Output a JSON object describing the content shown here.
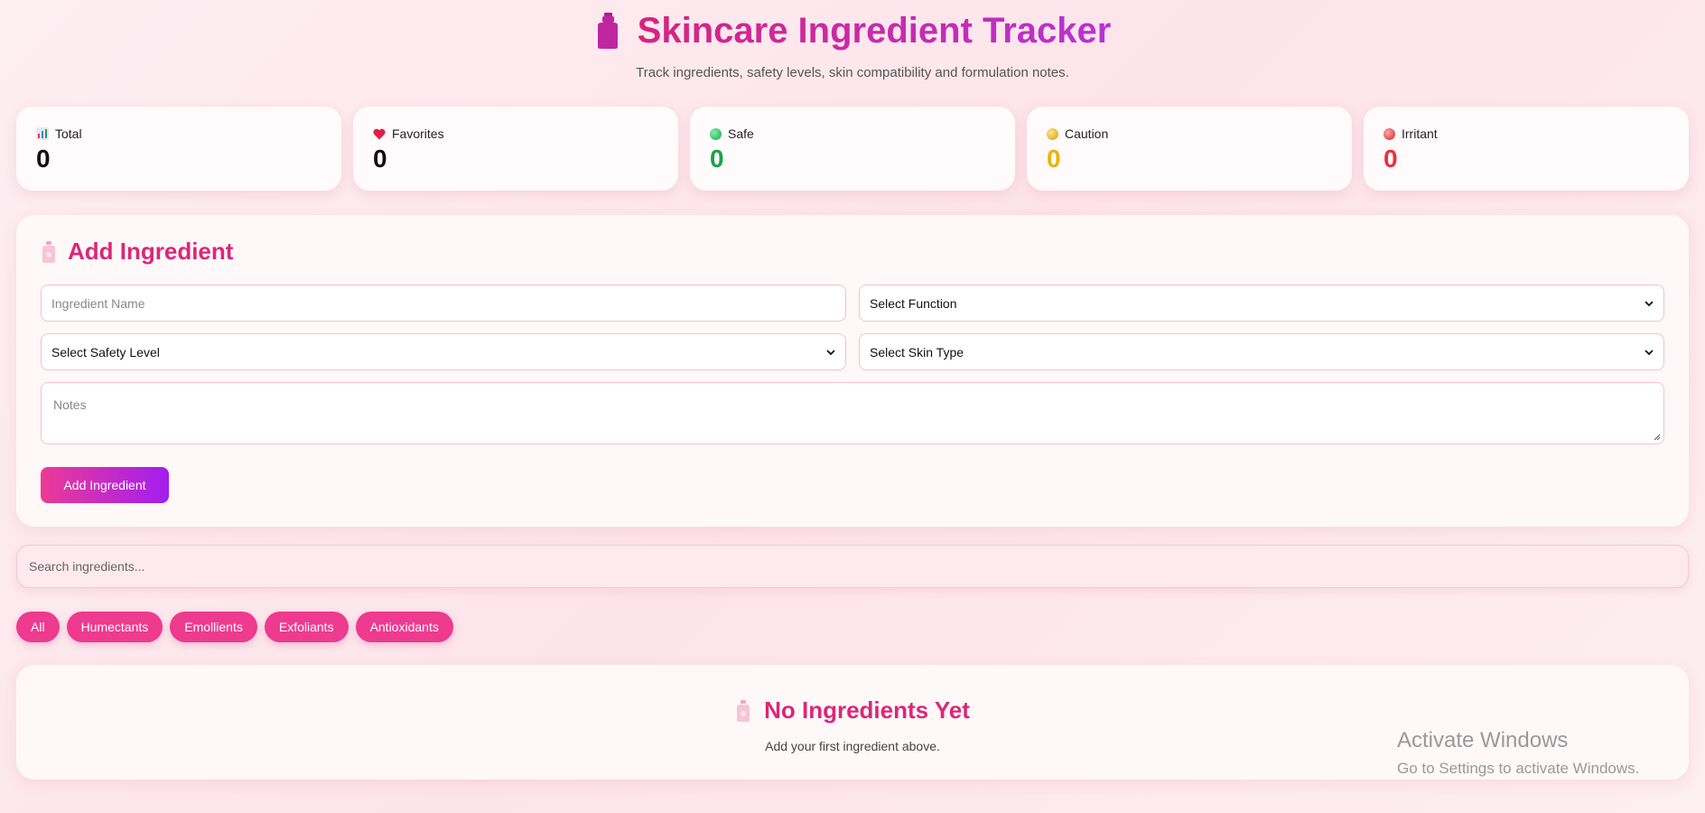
{
  "header": {
    "title": "Skincare Ingredient Tracker",
    "subtitle": "Track ingredients, safety levels, skin compatibility and formulation notes.",
    "icon": "lotion-bottle-icon"
  },
  "stats": [
    {
      "label": "Total",
      "value": "0",
      "icon": "bar-chart-icon",
      "color": "#111111"
    },
    {
      "label": "Favorites",
      "value": "0",
      "icon": "heart-icon",
      "color": "#111111"
    },
    {
      "label": "Safe",
      "value": "0",
      "icon": "green-circle-icon",
      "color": "#16a34a"
    },
    {
      "label": "Caution",
      "value": "0",
      "icon": "yellow-circle-icon",
      "color": "#eab308"
    },
    {
      "label": "Irritant",
      "value": "0",
      "icon": "red-circle-icon",
      "color": "#ef2d3d"
    }
  ],
  "add_form": {
    "title": "Add Ingredient",
    "name_placeholder": "Ingredient Name",
    "function_select": "Select Function",
    "safety_select": "Select Safety Level",
    "skin_select": "Select Skin Type",
    "notes_placeholder": "Notes",
    "submit_label": "Add Ingredient"
  },
  "search": {
    "placeholder": "Search ingredients..."
  },
  "filters": [
    "All",
    "Humectants",
    "Emollients",
    "Exfoliants",
    "Antioxidants"
  ],
  "empty_state": {
    "title": "No Ingredients Yet",
    "subtitle": "Add your first ingredient above."
  },
  "watermark": {
    "line1": "Activate Windows",
    "line2": "Go to Settings to activate Windows."
  },
  "colors": {
    "accent": "#db2777",
    "brand_gradient_start": "#ec3a95",
    "brand_gradient_end": "#a21ef0"
  }
}
